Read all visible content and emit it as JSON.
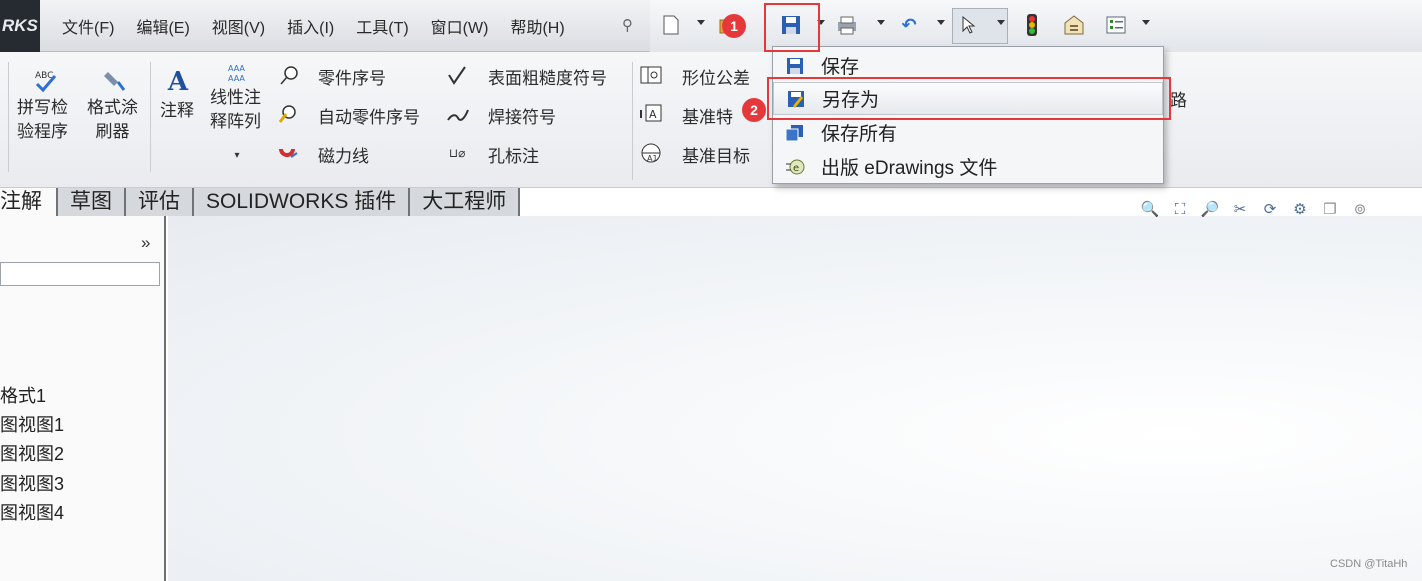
{
  "app": {
    "logo_text": "RKS"
  },
  "menubar": {
    "items": [
      "文件(F)",
      "编辑(E)",
      "视图(V)",
      "插入(I)",
      "工具(T)",
      "窗口(W)",
      "帮助(H)"
    ]
  },
  "ribbon": {
    "spell_check": "拼写检\n验程序",
    "format_painter": "格式涂\n刷器",
    "note": "注释",
    "linear_note_pattern": "线性注\n释阵列",
    "balloon": "零件序号",
    "auto_balloon": "自动零件序号",
    "magnetic_line": "磁力线",
    "surface_finish": "表面粗糙度符号",
    "weld_symbol": "焊接符号",
    "hole_callout": "孔标注",
    "geometric_tolerance": "形位公差",
    "datum_feature": "基准特",
    "datum_target": "基准目标",
    "partial_right": "路"
  },
  "tabs": [
    "注解",
    "草图",
    "评估",
    "SOLIDWORKS 插件",
    "大工程师"
  ],
  "panel": {
    "collapse_label": "»",
    "tree": [
      "格式1",
      "图视图1",
      "图视图2",
      "图视图3",
      "图视图4"
    ]
  },
  "dropdown": {
    "items": [
      "保存",
      "另存为",
      "保存所有",
      "出版 eDrawings 文件"
    ]
  },
  "annotations": {
    "badge1": "1",
    "badge2": "2"
  },
  "watermark": "CSDN @TitaHh",
  "colors": {
    "highlight_red": "#e5383b",
    "title_dark": "#262a31"
  }
}
